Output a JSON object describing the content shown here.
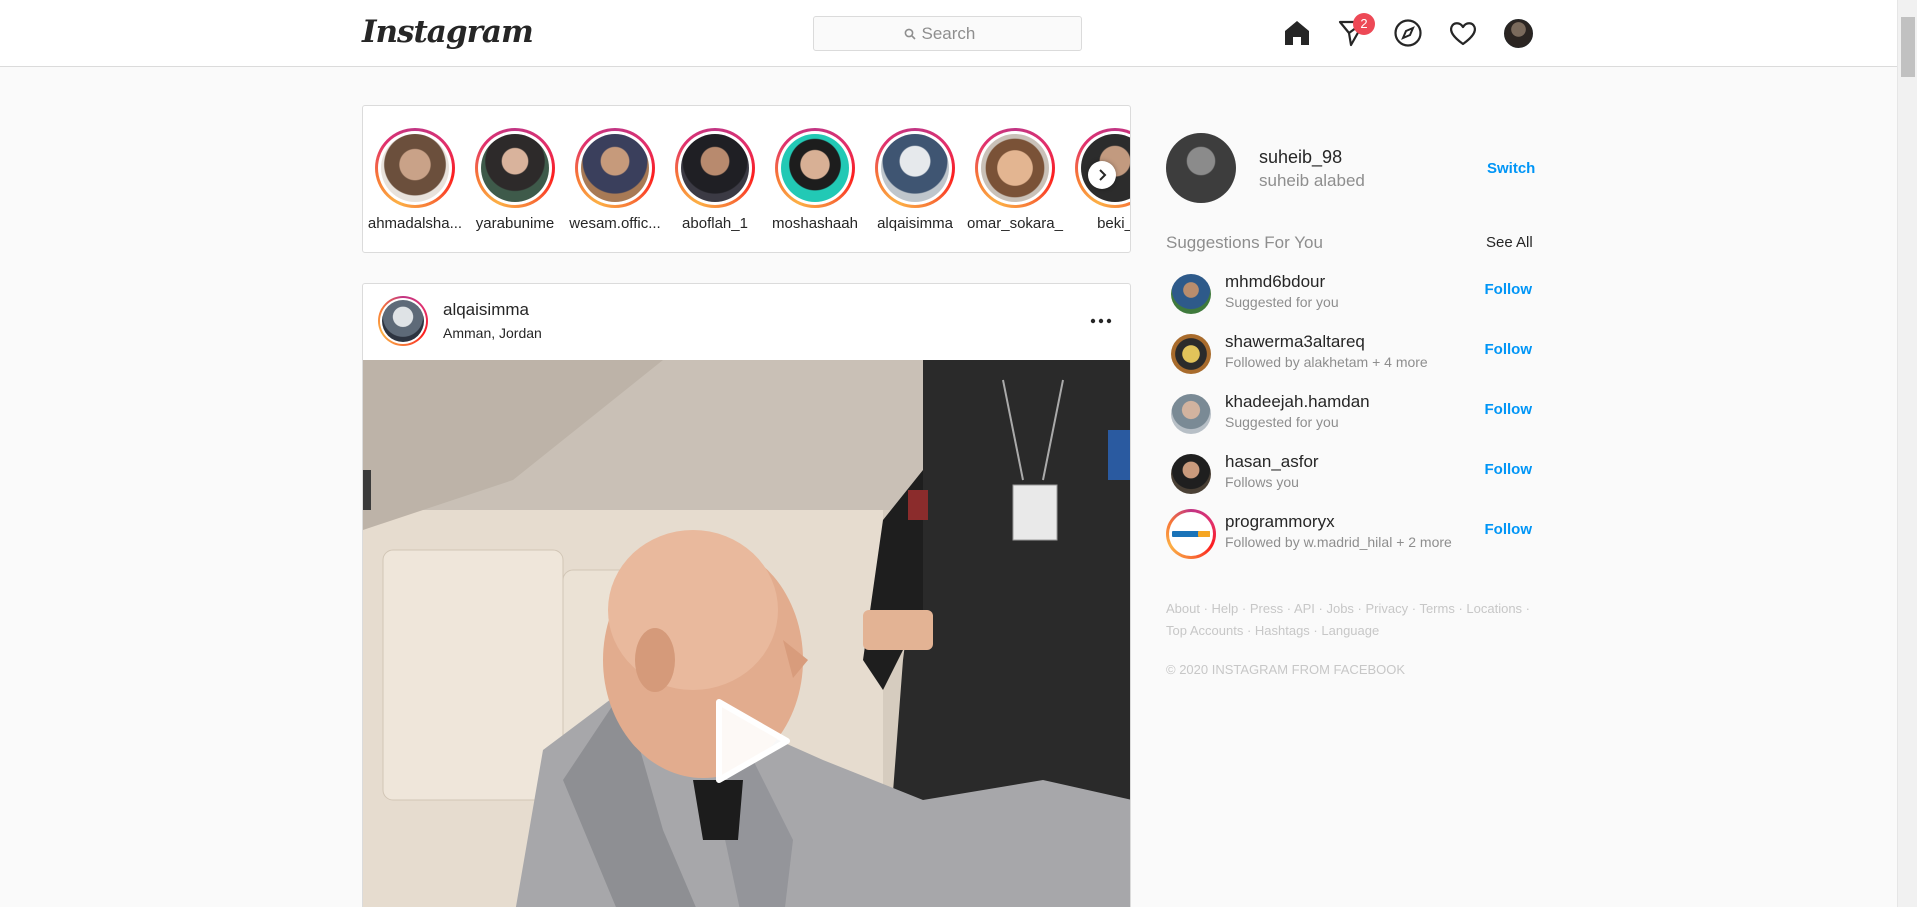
{
  "header": {
    "logo_text": "Instagram",
    "search_placeholder": "Search",
    "messages_badge": "2"
  },
  "stories": [
    {
      "name": "ahmadalsha..."
    },
    {
      "name": "yarabunime"
    },
    {
      "name": "wesam.offic..."
    },
    {
      "name": "aboflah_1"
    },
    {
      "name": "moshashaah"
    },
    {
      "name": "alqaisimma"
    },
    {
      "name": "omar_sokara_"
    },
    {
      "name": "beki_"
    }
  ],
  "post": {
    "username": "alqaisimma",
    "location": "Amman, Jordan"
  },
  "profile": {
    "username": "suheib_98",
    "full_name": "suheib alabed",
    "switch_label": "Switch"
  },
  "suggestions": {
    "heading": "Suggestions For You",
    "see_all": "See All",
    "follow_label": "Follow",
    "items": [
      {
        "username": "mhmd6bdour",
        "subtitle": "Suggested for you"
      },
      {
        "username": "shawerma3altareq",
        "subtitle": "Followed by alakhetam + 4 more"
      },
      {
        "username": "khadeejah.hamdan",
        "subtitle": "Suggested for you"
      },
      {
        "username": "hasan_asfor",
        "subtitle": "Follows you"
      },
      {
        "username": "programmoryx",
        "subtitle": "Followed by w.madrid_hilal + 2 more"
      }
    ]
  },
  "footer": {
    "links": [
      "About",
      "Help",
      "Press",
      "API",
      "Jobs",
      "Privacy",
      "Terms",
      "Locations",
      "Top Accounts",
      "Hashtags",
      "Language"
    ],
    "copyright": "© 2020 INSTAGRAM FROM FACEBOOK"
  },
  "icons": {
    "home": "home-icon",
    "direct": "direct-message-icon",
    "explore": "compass-icon",
    "activity": "heart-icon",
    "search": "search-icon",
    "more": "more-options-icon",
    "play": "play-icon",
    "next": "chevron-right-icon"
  },
  "colors": {
    "accent": "#0095f6",
    "badge": "#ed4956",
    "border": "#dbdbdb",
    "background": "#fafafa"
  }
}
